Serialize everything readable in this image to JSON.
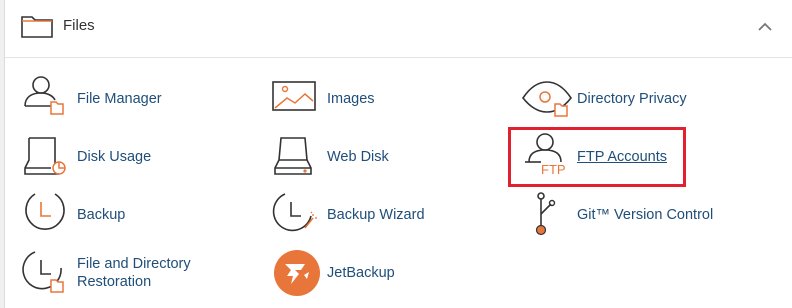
{
  "section": {
    "title": "Files",
    "accent_color": "#e8763a",
    "icon_color": "#333333"
  },
  "items": [
    {
      "label": "File Manager",
      "icon": "file-manager-icon"
    },
    {
      "label": "Images",
      "icon": "images-icon"
    },
    {
      "label": "Directory Privacy",
      "icon": "directory-privacy-icon"
    },
    {
      "label": "Disk Usage",
      "icon": "disk-usage-icon"
    },
    {
      "label": "Web Disk",
      "icon": "web-disk-icon"
    },
    {
      "label": "FTP Accounts",
      "icon": "ftp-accounts-icon",
      "icon_text": "FTP",
      "highlighted": true
    },
    {
      "label": "Backup",
      "icon": "backup-icon"
    },
    {
      "label": "Backup Wizard",
      "icon": "backup-wizard-icon"
    },
    {
      "label": "Git™ Version Control",
      "icon": "git-icon"
    },
    {
      "label_lines": [
        "File and Directory",
        "Restoration"
      ],
      "icon": "file-restoration-icon"
    },
    {
      "label": "JetBackup",
      "icon": "jetbackup-icon"
    }
  ]
}
